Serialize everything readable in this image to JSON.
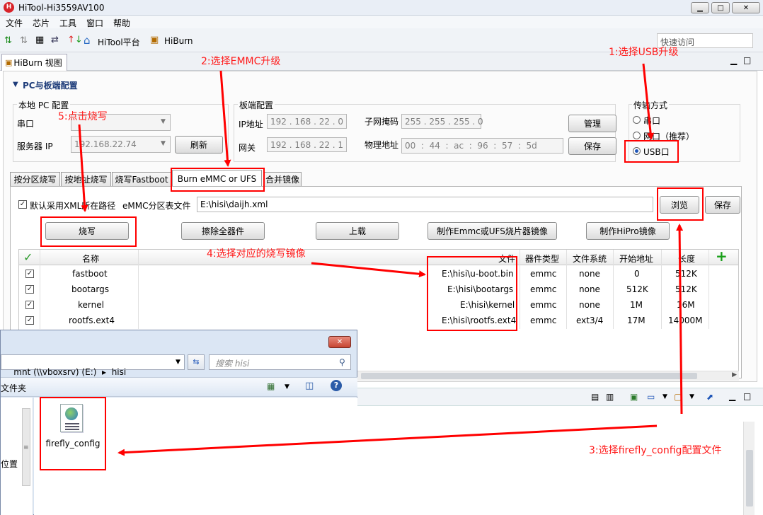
{
  "window": {
    "title": "HiTool-Hi3559AV100",
    "min": "▭",
    "max": "□",
    "close": "✕"
  },
  "menu": [
    "文件",
    "芯片",
    "工具",
    "窗口",
    "帮助"
  ],
  "toolbar": {
    "hitool_label": "HiTool平台",
    "hiburn_label": "HiBurn",
    "quick_access": "快速访问"
  },
  "view_tab": "HiBurn 视图",
  "section_title": "PC与板端配置",
  "local_pc": {
    "group": "本地 PC 配置",
    "serial_label": "串口",
    "serial_value": "",
    "server_ip_label": "服务器 IP",
    "server_ip_value": "192.168.22.74",
    "refresh": "刷新"
  },
  "board": {
    "group": "板端配置",
    "ip_label": "IP地址",
    "ip_value": "192 . 168 . 22 . 0",
    "gateway_label": "网关",
    "gateway_value": "192 . 168 . 22 . 1",
    "subnet_label": "子网掩码",
    "subnet_value": "255 . 255 . 255 . 0",
    "mac_label": "物理地址",
    "mac_value": "00  :  44  :  ac  :  96  :  57  :  5d",
    "manage": "管理",
    "save": "保存"
  },
  "transfer": {
    "group": "传输方式",
    "serial": "串口",
    "network": "网口（推荐）",
    "usb": "USB口",
    "selected": "USB口"
  },
  "tabs": [
    "按分区烧写",
    "按地址烧写",
    "烧写Fastboot",
    "Burn eMMC or UFS",
    "合并镜像"
  ],
  "burn": {
    "default_xml_label": "默认采用XML所在路径",
    "partition_label": "eMMC分区表文件",
    "partition_path": "E:\\hisi\\daijh.xml",
    "browse": "浏览",
    "save": "保存",
    "burn": "烧写",
    "erase": "擦除全器件",
    "upload": "上载",
    "make_emmc": "制作Emmc或UFS烧片器镜像",
    "make_hipro": "制作HiPro镜像"
  },
  "table": {
    "headers": [
      "名称",
      "文件",
      "器件类型",
      "文件系统",
      "开始地址",
      "长度"
    ],
    "rows": [
      {
        "name": "fastboot",
        "file": "E:\\hisi\\u-boot.bin",
        "type": "emmc",
        "fs": "none",
        "start": "0",
        "len": "512K"
      },
      {
        "name": "bootargs",
        "file": "E:\\hisi\\bootargs",
        "type": "emmc",
        "fs": "none",
        "start": "512K",
        "len": "512K"
      },
      {
        "name": "kernel",
        "file": "E:\\hisi\\kernel",
        "type": "emmc",
        "fs": "none",
        "start": "1M",
        "len": "16M"
      },
      {
        "name": "rootfs.ext4",
        "file": "E:\\hisi\\rootfs.ext4",
        "type": "emmc",
        "fs": "ext3/4",
        "start": "17M",
        "len": "14000M"
      }
    ]
  },
  "explorer": {
    "path": "mnt (\\\\vboxsrv) (E:)  ▸  hisi",
    "search_placeholder": "搜索 hisi",
    "folder_label": "文件夹",
    "side_label": "位置",
    "file_name": "firefly_config",
    "close": "✕"
  },
  "annotations": {
    "a1": "1:选择USB升级",
    "a2": "2:选择EMMC升级",
    "a3": "3:选择firefly_config配置文件",
    "a4": "4:选择对应的烧写镜像",
    "a5": "5:点击烧写"
  },
  "colors": {
    "accent_red": "#ff0000",
    "titlebar": "#e9eef6",
    "section_blue": "#1f3d7a"
  }
}
